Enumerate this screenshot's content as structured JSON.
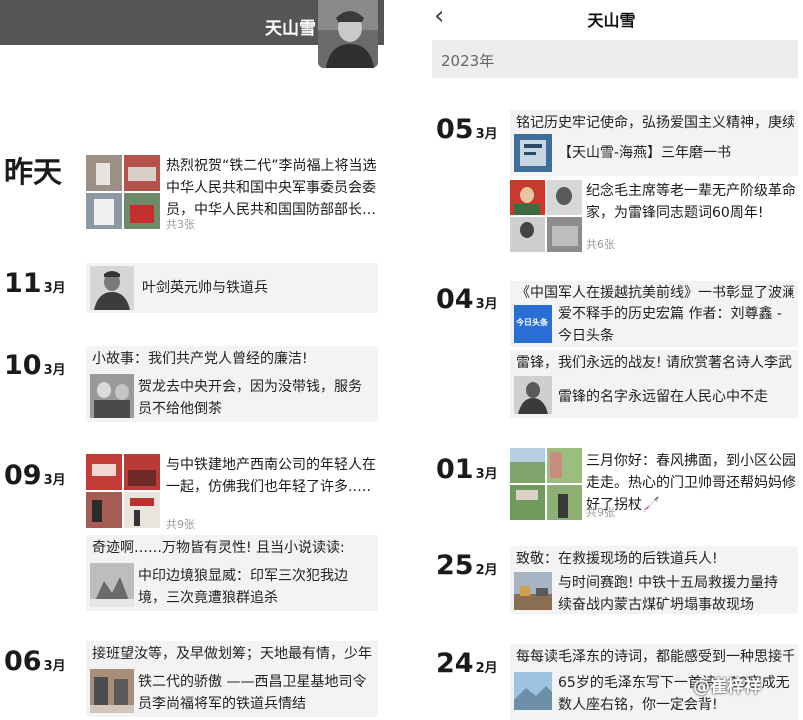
{
  "left": {
    "header_title": "天山雪",
    "entries": [
      {
        "date_text": "昨天",
        "text": "热烈祝贺“铁二代”李尚福上将当选中华人民共和国中央军事委员会委员，中华人民共和国国防部部长…",
        "count": "共3张"
      },
      {
        "day": "11",
        "month": "3月",
        "text": "叶剑英元帅与铁道兵"
      },
      {
        "day": "10",
        "month": "3月",
        "headline": "小故事：我们共产党人曾经的廉洁!",
        "text": "贺龙去中央开会，因为没带钱，服务员不给他倒茶"
      },
      {
        "day": "09",
        "month": "3月",
        "text": "与中铁建地产西南公司的年轻人在一起，仿佛我们也年轻了许多.….",
        "count": "共9张",
        "headline2": "奇迹啊……万物皆有灵性! 且当小说读读:",
        "text2": "中印边境狼显威：印军三次犯我边境，三次竟遭狼群追杀"
      },
      {
        "day": "06",
        "month": "3月",
        "headline": "接班望汝等，及早做划筹；天地最有情，少年",
        "text": "铁二代的骄傲 ——西昌卫星基地司令员李尚福将军的铁道兵情结"
      }
    ]
  },
  "right": {
    "back_icon": "‹",
    "header_title": "天山雪",
    "year": "2023年",
    "entries": [
      {
        "day": "05",
        "month": "3月",
        "headline": "铭记历史牢记使命，弘扬爱国主义精神，庚续",
        "text": "【天山雪-海燕】三年磨一书",
        "text2": "纪念毛主席等老一辈无产阶级革命家，为雷锋同志题词60周年!",
        "count": "共6张"
      },
      {
        "day": "04",
        "month": "3月",
        "headline": "《中国军人在援越抗美前线》一书彰显了波澜",
        "text": "爱不释手的历史宏篇 作者：刘尊鑫 - 今日头条",
        "thumb_label": "今日头条",
        "headline2": "雷锋，我们永远的战友! 请欣赏著名诗人李武",
        "text2": "雷锋的名字永远留在人民心中不走"
      },
      {
        "day": "01",
        "month": "3月",
        "text": "三月你好：春风拂面，到小区公园走走。热心的门卫帅哥还帮妈妈修好了拐杖🦯",
        "count": "共9张"
      },
      {
        "day": "25",
        "month": "2月",
        "headline": "致敬：在救援现场的后铁道兵人!",
        "text": "与时间赛跑! 中铁十五局救援力量持续奋战内蒙古煤矿坍塌事故现场"
      },
      {
        "day": "24",
        "month": "2月",
        "headline": "每每读毛泽东的诗词，都能感受到一种思接千",
        "text": "65岁的毛泽东写下一首诗，10字成无数人座右铭，你一定会背!"
      }
    ],
    "watermark": "@崔梓祥"
  }
}
